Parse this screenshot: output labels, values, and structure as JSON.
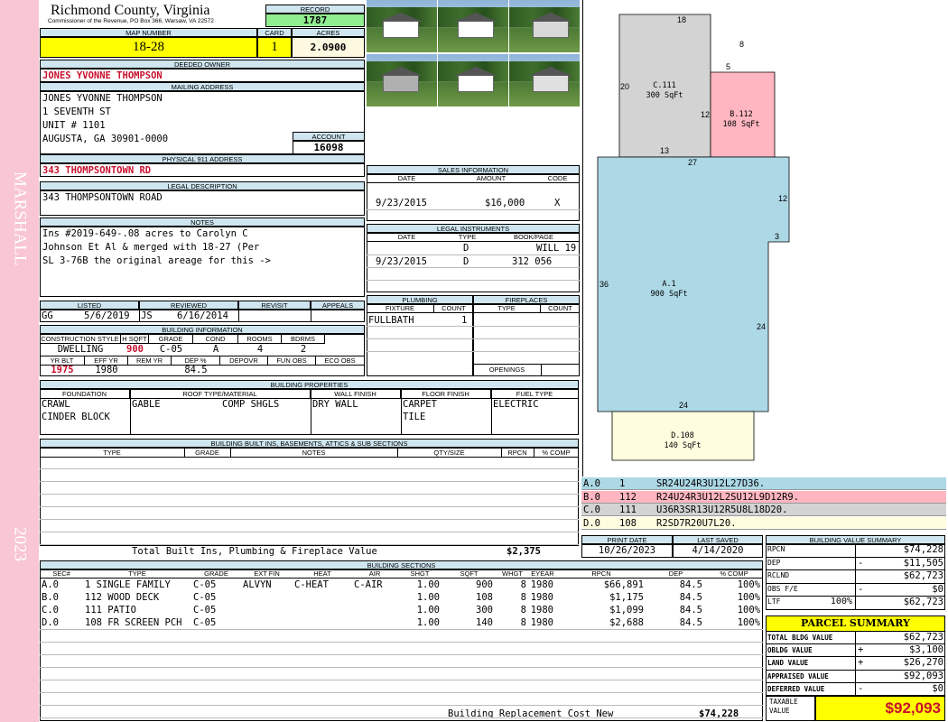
{
  "side": {
    "township": "MARSHALL",
    "year": "2023"
  },
  "header": {
    "county": "Richmond County, Virginia",
    "commissioner": "Commissioner of the Revenue, PO Box 366, Warsaw, VA 22572",
    "record_label": "RECORD",
    "record": "1787",
    "map_number_label": "MAP NUMBER",
    "map_number": "18-28",
    "card_label": "CARD",
    "card": "1",
    "acres_label": "ACRES",
    "acres": "2.0900"
  },
  "owner": {
    "deeded_owner_label": "DEEDED OWNER",
    "deeded_owner": "JONES YVONNE THOMPSON",
    "mailing_label": "MAILING ADDRESS",
    "mailing": [
      "JONES YVONNE THOMPSON",
      "1 SEVENTH ST",
      "UNIT # 1101",
      "AUGUSTA, GA 30901-0000"
    ],
    "account_label": "ACCOUNT",
    "account": "16098",
    "physical_label": "PHYSICAL 911 ADDRESS",
    "physical": "343 THOMPSONTOWN RD",
    "legal_label": "LEGAL DESCRIPTION",
    "legal": "343 THOMPSONTOWN ROAD",
    "notes_label": "NOTES",
    "notes": [
      "Ins #2019-649-.08 acres to Carolyn C",
      "Johnson Et Al & merged with 18-27 (Per",
      "SL 3-76B the original areage for this ->"
    ]
  },
  "sales": {
    "label": "SALES INFORMATION",
    "cols": [
      "DATE",
      "AMOUNT",
      "CODE"
    ],
    "rows": [
      {
        "date": "9/23/2015",
        "amount": "$16,000",
        "code": "X"
      }
    ]
  },
  "legal_instruments": {
    "label": "LEGAL INSTRUMENTS",
    "cols": [
      "DATE",
      "TYPE",
      "BOOK/PAGE"
    ],
    "rows": [
      {
        "date": "",
        "type": "D",
        "book": "WILL 19"
      },
      {
        "date": "9/23/2015",
        "type": "D",
        "book": "312 056"
      }
    ]
  },
  "review": {
    "cols": [
      "LISTED",
      "REVIEWED",
      "REVISIT",
      "APPEALS"
    ],
    "listed_by": "GG",
    "listed_date": "5/6/2019",
    "reviewed_by": "JS",
    "reviewed_date": "6/16/2014"
  },
  "building_info": {
    "label": "BUILDING INFORMATION",
    "cols1": [
      "CONSTRUCTION STYLE",
      "H SQFT",
      "GRADE",
      "COND",
      "ROOMS",
      "BDRMS"
    ],
    "vals1": [
      "DWELLING",
      "900",
      "C-05",
      "A",
      "4",
      "2"
    ],
    "cols2": [
      "YR BLT",
      "EFF YR",
      "REM YR",
      "DEP %",
      "DEPOVR",
      "FUN OBS",
      "ECO OBS"
    ],
    "vals2": [
      "1975",
      "1980",
      "",
      "84.5",
      "",
      "",
      ""
    ]
  },
  "plumbing": {
    "label": "PLUMBING",
    "cols": [
      "FIXTURE",
      "COUNT"
    ],
    "rows": [
      {
        "fixture": "FULLBATH",
        "count": "1"
      }
    ]
  },
  "fireplaces": {
    "label": "FIREPLACES",
    "cols": [
      "TYPE",
      "COUNT"
    ],
    "openings": "OPENINGS"
  },
  "properties": {
    "label": "BUILDING PROPERTIES",
    "cols": [
      "FOUNDATION",
      "ROOF TYPE/MATERIAL",
      "WALL FINISH",
      "FLOOR FINISH",
      "FUEL TYPE"
    ],
    "foundation": [
      "CRAWL",
      "CINDER BLOCK"
    ],
    "roof_type": "GABLE",
    "roof_material": "COMP SHGLS",
    "wall": "DRY WALL",
    "floor": [
      "CARPET",
      "TILE"
    ],
    "fuel": "ELECTRIC"
  },
  "builtins": {
    "label": "BUILDING BUILT INS, BASEMENTS, ATTICS & SUB SECTIONS",
    "cols": [
      "TYPE",
      "GRADE",
      "NOTES",
      "QTY/SIZE",
      "RPCN",
      "% COMP"
    ],
    "total_label": "Total Built Ins, Plumbing & Fireplace Value",
    "total": "$2,375"
  },
  "print": {
    "print_label": "PRINT DATE",
    "print_date": "10/26/2023",
    "saved_label": "LAST SAVED",
    "saved_date": "4/14/2020"
  },
  "sections": {
    "label": "BUILDING SECTIONS",
    "cols": [
      "SEC#",
      "TYPE",
      "GRADE",
      "EXT FIN",
      "HEAT",
      "AIR",
      "SHGT",
      "SQFT",
      "WHGT",
      "EYEAR",
      "RPCN",
      "DEP",
      "% COMP"
    ],
    "rows": [
      [
        "A.0",
        "1 SINGLE FAMILY",
        "C-05",
        "ALVYN",
        "C-HEAT",
        "C-AIR",
        "1.00",
        "900",
        "8",
        "1980",
        "$66,891",
        "84.5",
        "100%"
      ],
      [
        "B.0",
        "112 WOOD DECK",
        "C-05",
        "",
        "",
        "",
        "1.00",
        "108",
        "8",
        "1980",
        "$1,175",
        "84.5",
        "100%"
      ],
      [
        "C.0",
        "111 PATIO",
        "C-05",
        "",
        "",
        "",
        "1.00",
        "300",
        "8",
        "1980",
        "$1,099",
        "84.5",
        "100%"
      ],
      [
        "D.0",
        "108 FR SCREEN PCH",
        "C-05",
        "",
        "",
        "",
        "1.00",
        "140",
        "8",
        "1980",
        "$2,688",
        "84.5",
        "100%"
      ]
    ],
    "replacement_label": "Building Replacement Cost New",
    "replacement": "$74,228"
  },
  "sketch_legend": [
    {
      "sec": "A.0",
      "code": "1",
      "vectors": "SR24U24R3U12L27D36.",
      "color": "#add8e6"
    },
    {
      "sec": "B.0",
      "code": "112",
      "vectors": "R24U24R3U12L2SU12L9D12R9.",
      "color": "#ffb6c1"
    },
    {
      "sec": "C.0",
      "code": "111",
      "vectors": "U36R3SR13U12R5U8L18D20.",
      "color": "#d3d3d3"
    },
    {
      "sec": "D.0",
      "code": "108",
      "vectors": "R2SD7R20U7L20.",
      "color": "#fffde0"
    }
  ],
  "sketch": {
    "areas": [
      {
        "id": "A.1",
        "sqft": "900 SqFt",
        "color": "#add8e6"
      },
      {
        "id": "B.112",
        "sqft": "108 SqFt",
        "color": "#ffb6c1"
      },
      {
        "id": "C.111",
        "sqft": "300 SqFt",
        "color": "#d3d3d3"
      },
      {
        "id": "D.108",
        "sqft": "140 SqFt",
        "color": "#fffde0"
      }
    ],
    "dims": [
      "18",
      "8",
      "5",
      "20",
      "12",
      "13",
      "27",
      "12",
      "3",
      "36",
      "24",
      "24"
    ]
  },
  "value_summary": {
    "label": "BUILDING VALUE SUMMARY",
    "rows": [
      {
        "label": "RPCN",
        "sign": "",
        "pct": "",
        "value": "$74,228"
      },
      {
        "label": "DEP",
        "sign": "-",
        "pct": "",
        "value": "$11,505"
      },
      {
        "label": "RCLND",
        "sign": "",
        "pct": "",
        "value": "$62,723"
      },
      {
        "label": "OBS F/E",
        "sign": "-",
        "pct": "",
        "value": "$0"
      },
      {
        "label": "LTF",
        "sign": "",
        "pct": "100%",
        "value": "$62,723"
      }
    ]
  },
  "parcel": {
    "label": "PARCEL SUMMARY",
    "rows": [
      {
        "label": "TOTAL BLDG VALUE",
        "sign": "",
        "value": "$62,723"
      },
      {
        "label": "OBLDG VALUE",
        "sign": "+",
        "value": "$3,100"
      },
      {
        "label": "LAND VALUE",
        "sign": "+",
        "value": "$26,270"
      },
      {
        "label": "APPRAISED VALUE",
        "sign": "",
        "value": "$92,093"
      },
      {
        "label": "DEFERRED VALUE",
        "sign": "-",
        "value": "$0"
      }
    ],
    "taxable_label": "TAXABLE VALUE",
    "taxable": "$92,093"
  }
}
